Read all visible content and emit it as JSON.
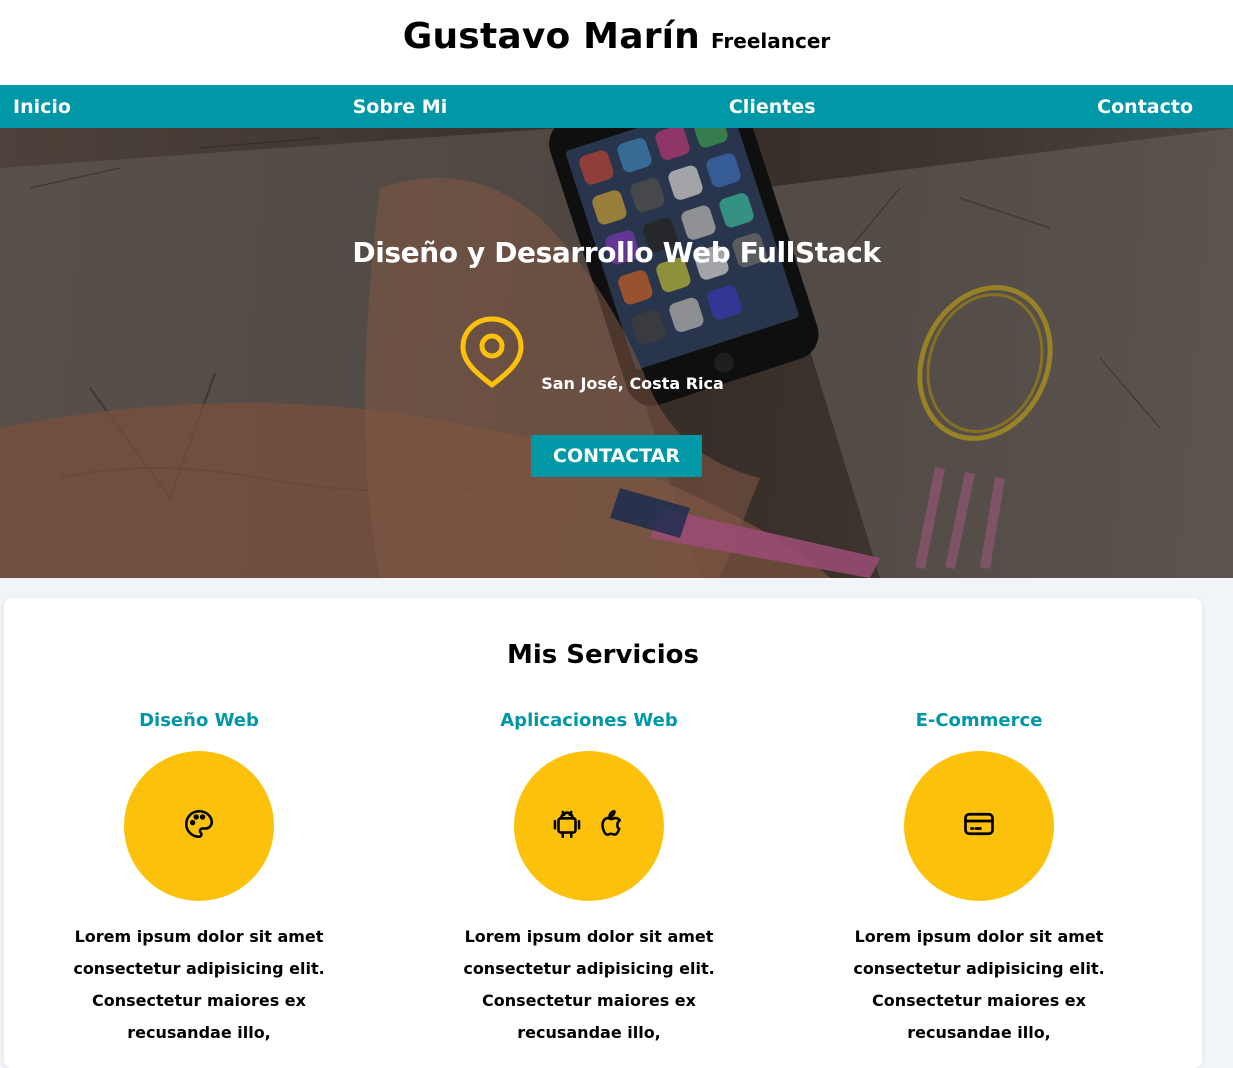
{
  "header": {
    "name": "Gustavo Marín",
    "role": "Freelancer"
  },
  "nav": {
    "items": [
      {
        "label": "Inicio"
      },
      {
        "label": "Sobre Mi"
      },
      {
        "label": "Clientes"
      },
      {
        "label": "Contacto"
      }
    ]
  },
  "hero": {
    "title": "Diseño y Desarrollo Web FullStack",
    "location": "San José, Costa Rica",
    "location_icon": "map-pin-icon",
    "button_label": "CONTACTAR"
  },
  "services": {
    "title": "Mis Servicios",
    "items": [
      {
        "title": "Diseño Web",
        "icon": "palette-icon",
        "text": "Lorem ipsum dolor sit amet consectetur adipisicing elit. Consectetur maiores ex recusandae illo,"
      },
      {
        "title": "Aplicaciones Web",
        "icon": "android-apple-icons",
        "text": "Lorem ipsum dolor sit amet consectetur adipisicing elit. Consectetur maiores ex recusandae illo,"
      },
      {
        "title": "E-Commerce",
        "icon": "credit-card-icon",
        "text": "Lorem ipsum dolor sit amet consectetur adipisicing elit. Consectetur maiores ex recusandae illo,"
      }
    ]
  },
  "colors": {
    "accent": "#0097a7",
    "highlight": "#fbc10b",
    "text": "#000000"
  }
}
